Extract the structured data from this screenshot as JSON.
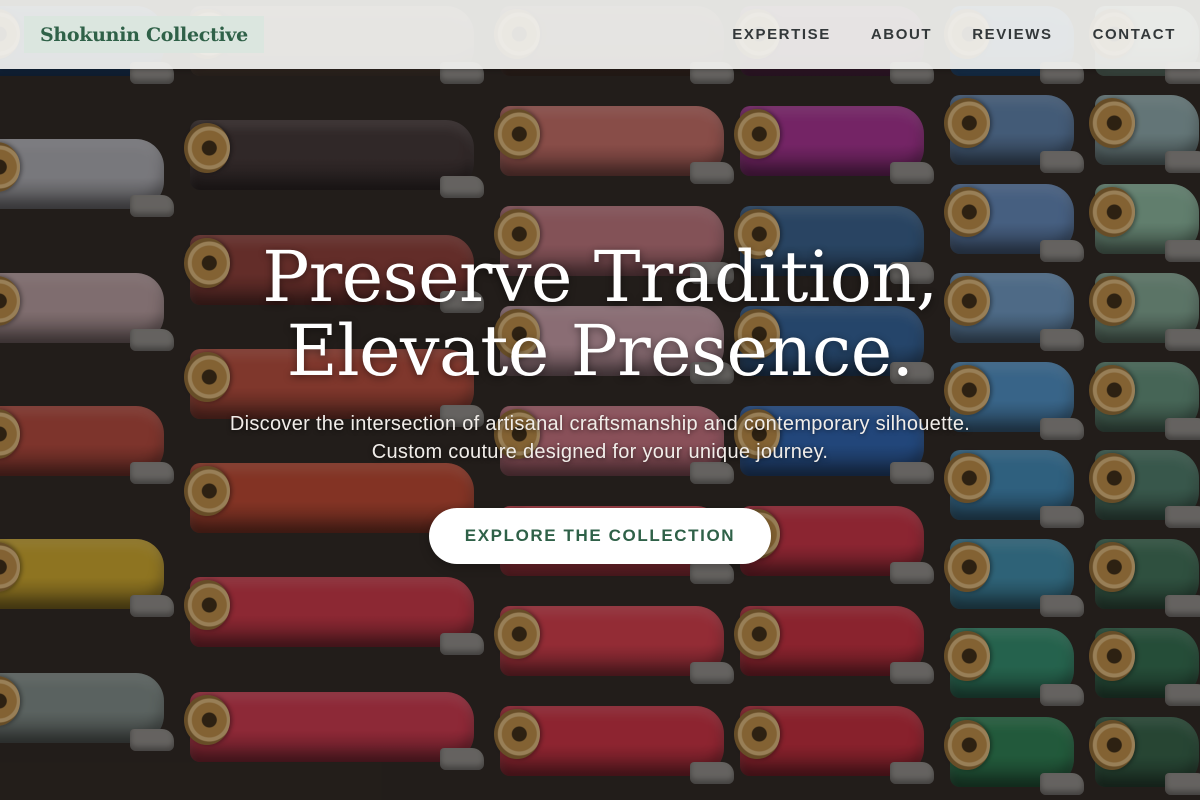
{
  "header": {
    "brand": "Shokunin Collective",
    "nav": [
      {
        "label": "EXPERTISE"
      },
      {
        "label": "ABOUT"
      },
      {
        "label": "REVIEWS"
      },
      {
        "label": "CONTACT"
      }
    ]
  },
  "hero": {
    "title_line1": "Preserve Tradition,",
    "title_line2": "Elevate Presence.",
    "subtitle_line1": "Discover the intersection of artisanal craftsmanship and contemporary silhouette.",
    "subtitle_line2": "Custom couture designed for your unique journey.",
    "cta_label": "EXPLORE THE COLLECTION",
    "background_image": "thread-spools-photo"
  },
  "colors": {
    "brand_green": "#2f6148",
    "brand_bg": "#dbe6df",
    "header_bg": "#f2f2f0",
    "nav_text": "#33383a",
    "cta_bg": "#ffffff"
  }
}
